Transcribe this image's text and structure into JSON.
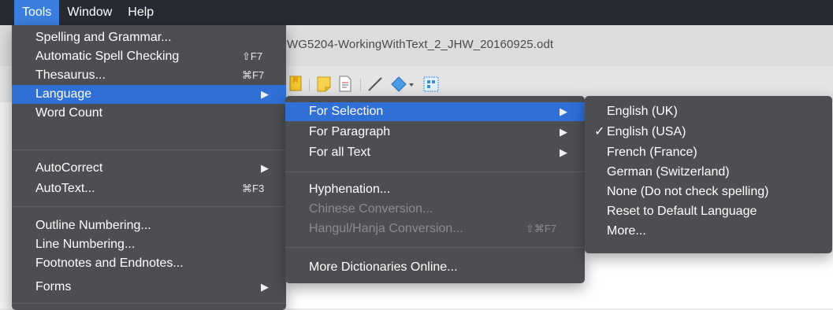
{
  "menubar": {
    "items": [
      {
        "label": "Tools"
      },
      {
        "label": "Window"
      },
      {
        "label": "Help"
      }
    ]
  },
  "window": {
    "title": "WG5204-WorkingWithText_2_JHW_20160925.odt"
  },
  "tools_menu": {
    "items": [
      {
        "label": "Spelling and Grammar...",
        "shortcut": ""
      },
      {
        "label": "Automatic Spell Checking",
        "shortcut": "⇧F7"
      },
      {
        "label": "Thesaurus...",
        "shortcut": "⌘F7"
      },
      {
        "label": "Language",
        "shortcut": "▶"
      },
      {
        "label": "Word Count",
        "shortcut": ""
      },
      {
        "label": "AutoCorrect",
        "shortcut": "▶"
      },
      {
        "label": "AutoText...",
        "shortcut": "⌘F3"
      },
      {
        "label": "Outline Numbering...",
        "shortcut": ""
      },
      {
        "label": "Line Numbering...",
        "shortcut": ""
      },
      {
        "label": "Footnotes and Endnotes...",
        "shortcut": ""
      },
      {
        "label": "Forms",
        "shortcut": "▶"
      }
    ]
  },
  "language_menu": {
    "items": [
      {
        "label": "For Selection",
        "shortcut": "▶"
      },
      {
        "label": "For Paragraph",
        "shortcut": "▶"
      },
      {
        "label": "For all Text",
        "shortcut": "▶"
      },
      {
        "label": "Hyphenation...",
        "shortcut": ""
      },
      {
        "label": "Chinese Conversion...",
        "shortcut": ""
      },
      {
        "label": "Hangul/Hanja Conversion...",
        "shortcut": "⇧⌘F7"
      },
      {
        "label": "More Dictionaries Online...",
        "shortcut": ""
      }
    ]
  },
  "selection_menu": {
    "checkmark": "✓",
    "items": [
      {
        "label": "English (UK)"
      },
      {
        "label": "English (USA)"
      },
      {
        "label": "French (France)"
      },
      {
        "label": "German (Switzerland)"
      },
      {
        "label": "None (Do not check spelling)"
      },
      {
        "label": "Reset to Default Language"
      },
      {
        "label": "More..."
      }
    ]
  },
  "colors": {
    "menubar_bg": "#252a33",
    "menu_bg": "#484a4e",
    "highlight": "#2f6fd6",
    "active_menubar": "#3a7ee0"
  }
}
